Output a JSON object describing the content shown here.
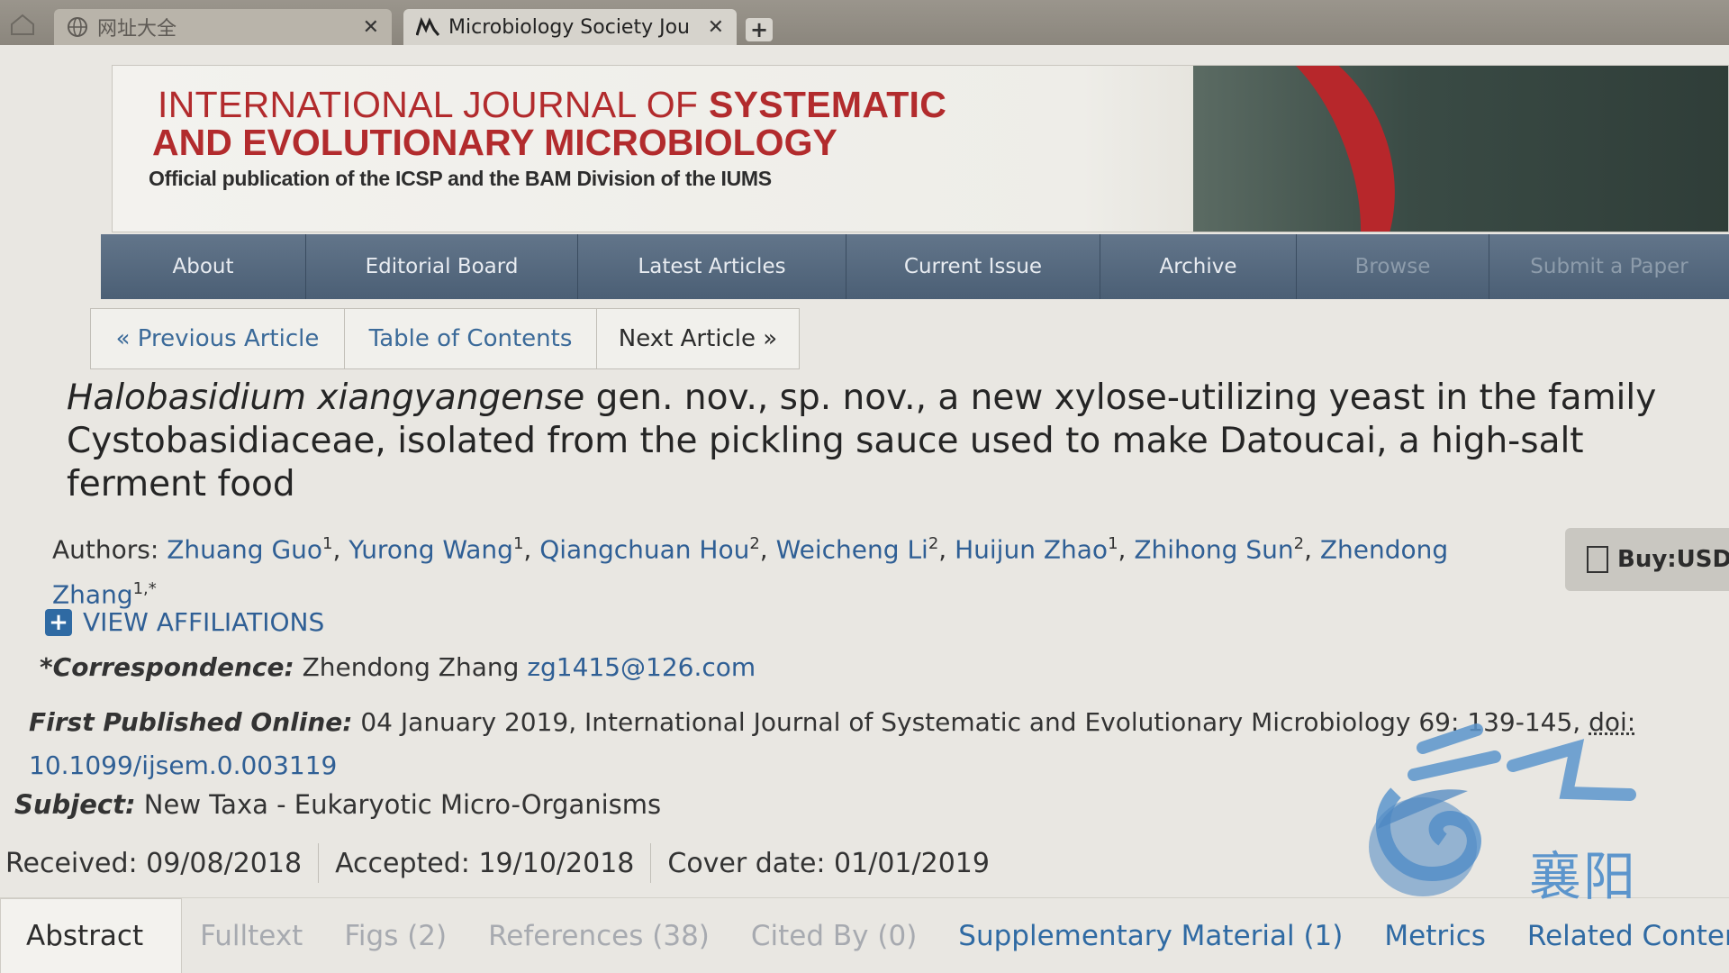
{
  "browser": {
    "tabs": [
      {
        "label": "网址大全",
        "close": "✕"
      },
      {
        "label": "Microbiology Society Jou",
        "close": "✕"
      }
    ],
    "new_tab": "+"
  },
  "banner": {
    "title_line1_light": "INTERNATIONAL JOURNAL OF ",
    "title_line1_bold": "SYSTEMATIC",
    "title_line2": "AND EVOLUTIONARY MICROBIOLOGY",
    "subtitle": "Official publication of the ICSP and the BAM Division of the IUMS"
  },
  "nav": {
    "items": [
      "About",
      "Editorial Board",
      "Latest Articles",
      "Current Issue",
      "Archive",
      "Browse",
      "Submit a Paper"
    ]
  },
  "article_nav": {
    "previous": "« Previous Article",
    "toc": "Table of Contents",
    "next": "Next Article »"
  },
  "article": {
    "title_species": "Halobasidium xiangyangense",
    "title_rest": " gen. nov., sp. nov., a new xylose-utilizing yeast in the family Cystobasidiaceae, isolated from the pickling sauce used to make Datoucai, a high-salt ferment food",
    "authors_label": "Authors: ",
    "authors": [
      {
        "name": "Zhuang Guo",
        "sup": "1"
      },
      {
        "name": "Yurong Wang",
        "sup": "1"
      },
      {
        "name": "Qiangchuan Hou",
        "sup": "2"
      },
      {
        "name": "Weicheng Li",
        "sup": "2"
      },
      {
        "name": "Huijun Zhao",
        "sup": "1"
      },
      {
        "name": "Zhihong Sun",
        "sup": "2"
      },
      {
        "name": "Zhendong Zhang",
        "sup": "1,*"
      }
    ],
    "buy_label": "Buy:USD",
    "view_affiliations": "VIEW AFFILIATIONS",
    "correspondence_label": "*Correspondence:",
    "correspondence_name": " Zhendong Zhang ",
    "correspondence_email": "zg1415@126.com",
    "published_label": "First Published Online:",
    "published_text": " 04 January 2019, International Journal of Systematic and Evolutionary Microbiology 69: 139-145, ",
    "doi_label": "doi:",
    "doi": "10.1099/ijsem.0.003119",
    "subject_label": "Subject:",
    "subject": " New Taxa - Eukaryotic Micro-Organisms",
    "received": "Received: 09/08/2018",
    "accepted": "Accepted: 19/10/2018",
    "cover_date": "Cover date: 01/01/2019"
  },
  "tabs": {
    "abstract": "Abstract",
    "fulltext": "Fulltext",
    "figs": "Figs (2)",
    "references": "References (38)",
    "cited_by": "Cited By (0)",
    "supplementary": "Supplementary Material (1)",
    "metrics": "Metrics",
    "related": "Related Content"
  },
  "watermark": {
    "text": "襄阳",
    "logo_top": "云上"
  },
  "colors": {
    "nav_bg": "#566a80",
    "link": "#2f5f95",
    "journal_red": "#b22b2d"
  }
}
